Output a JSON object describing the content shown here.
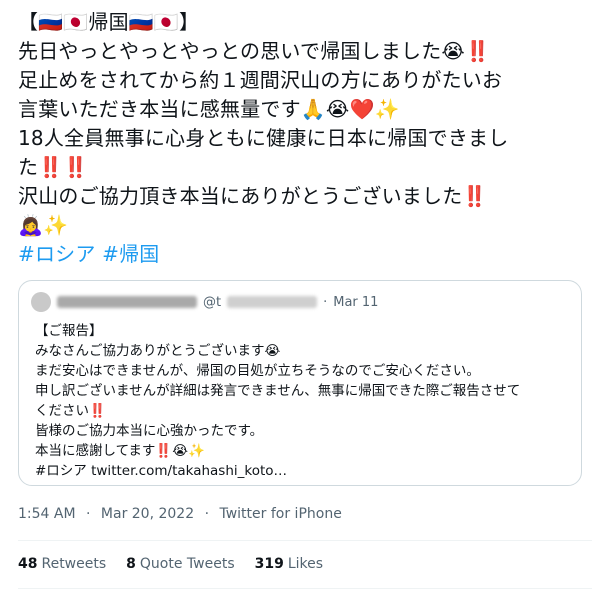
{
  "tweet": {
    "lines": [
      "【🇷🇺🇯🇵帰国🇷🇺🇯🇵】",
      "先日やっとやっとやっとの思いで帰国しました😭‼️",
      "足止めをされてから約１週間沢山の方にありがたいお",
      "言葉いただき本当に感無量です🙏😭❤️✨",
      "18人全員無事に心身ともに健康に日本に帰国できまし",
      "た‼️‼️",
      "沢山のご協力頂き本当にありがとうございました‼️",
      "🙇‍♀️✨"
    ],
    "hashtag_1": "#ロシア",
    "hashtag_2": "#帰国"
  },
  "quote": {
    "handle_prefix": "@t",
    "date": "Mar 11",
    "lines": [
      "【ご報告】",
      "みなさんご協力ありがとうございます😭",
      "まだ安心はできませんが、帰国の目処が立ちそうなのでご安心ください。",
      "申し訳ございませんが詳細は発言できません、無事に帰国できた際ご報告させて",
      "ください‼️",
      "皆様のご協力本当に心強かったです。",
      "本当に感謝してます‼️😭✨",
      "#ロシア twitter.com/takahashi_koto…"
    ]
  },
  "meta": {
    "time": "1:54 AM",
    "date": "Mar 20, 2022",
    "source": "Twitter for iPhone"
  },
  "stats": {
    "retweets_count": "48",
    "retweets_label": "Retweets",
    "quotes_count": "8",
    "quotes_label": "Quote Tweets",
    "likes_count": "319",
    "likes_label": "Likes"
  }
}
